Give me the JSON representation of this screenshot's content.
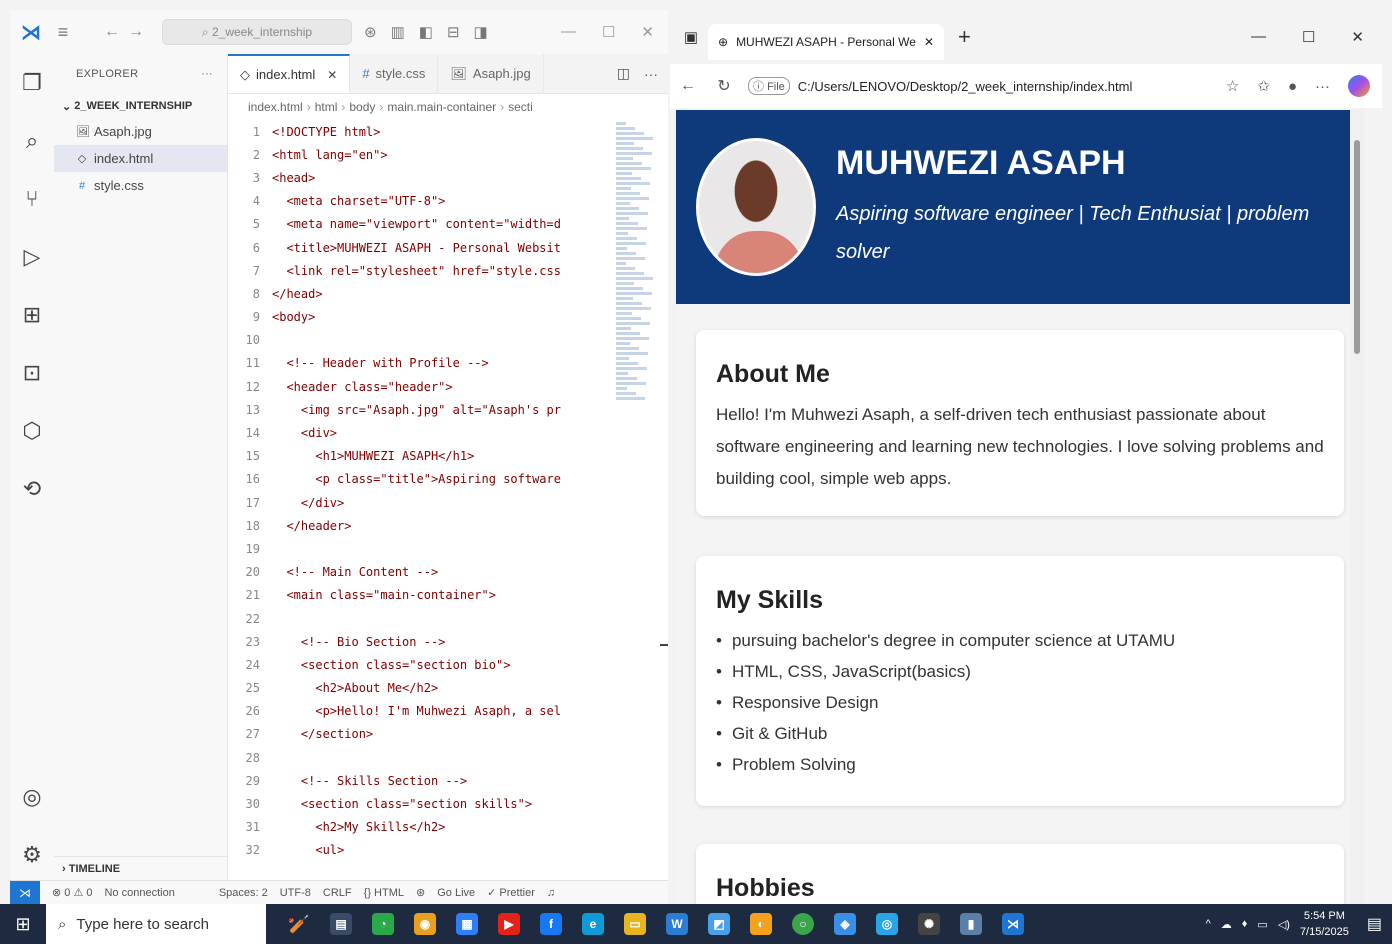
{
  "vscode": {
    "search_text": "2_week_internship",
    "explorer_label": "EXPLORER",
    "folder_name": "2_WEEK_INTERNSHIP",
    "files": [
      {
        "icon": "🖼",
        "name": "Asaph.jpg"
      },
      {
        "icon": "◇",
        "name": "index.html"
      },
      {
        "icon": "#",
        "name": "style.css"
      }
    ],
    "timeline_label": "TIMELINE",
    "tabs": [
      {
        "icon": "◇",
        "label": "index.html"
      },
      {
        "icon": "#",
        "label": "style.css"
      },
      {
        "icon": "🖼",
        "label": "Asaph.jpg"
      }
    ],
    "breadcrumb": [
      "index.html",
      "html",
      "body",
      "main.main-container",
      "secti"
    ],
    "code_lines": [
      {
        "n": "1",
        "text": "<!DOCTYPE html>"
      },
      {
        "n": "2",
        "text": "<html lang=\"en\">"
      },
      {
        "n": "3",
        "text": "<head>"
      },
      {
        "n": "4",
        "text": "  <meta charset=\"UTF-8\">"
      },
      {
        "n": "5",
        "text": "  <meta name=\"viewport\" content=\"width=d"
      },
      {
        "n": "6",
        "text": "  <title>MUHWEZI ASAPH - Personal Websit"
      },
      {
        "n": "7",
        "text": "  <link rel=\"stylesheet\" href=\"style.css"
      },
      {
        "n": "8",
        "text": "</head>"
      },
      {
        "n": "9",
        "text": "<body>"
      },
      {
        "n": "10",
        "text": ""
      },
      {
        "n": "11",
        "text": "  <!-- Header with Profile -->"
      },
      {
        "n": "12",
        "text": "  <header class=\"header\">"
      },
      {
        "n": "13",
        "text": "    <img src=\"Asaph.jpg\" alt=\"Asaph's pr"
      },
      {
        "n": "14",
        "text": "    <div>"
      },
      {
        "n": "15",
        "text": "      <h1>MUHWEZI ASAPH</h1>"
      },
      {
        "n": "16",
        "text": "      <p class=\"title\">Aspiring software"
      },
      {
        "n": "17",
        "text": "    </div>"
      },
      {
        "n": "18",
        "text": "  </header>"
      },
      {
        "n": "19",
        "text": ""
      },
      {
        "n": "20",
        "text": "  <!-- Main Content -->"
      },
      {
        "n": "21",
        "text": "  <main class=\"main-container\">"
      },
      {
        "n": "22",
        "text": ""
      },
      {
        "n": "23",
        "text": "    <!-- Bio Section -->"
      },
      {
        "n": "24",
        "text": "    <section class=\"section bio\">"
      },
      {
        "n": "25",
        "text": "      <h2>About Me</h2>"
      },
      {
        "n": "26",
        "text": "      <p>Hello! I'm Muhwezi Asaph, a sel"
      },
      {
        "n": "27",
        "text": "    </section>"
      },
      {
        "n": "28",
        "text": ""
      },
      {
        "n": "29",
        "text": "    <!-- Skills Section -->"
      },
      {
        "n": "30",
        "text": "    <section class=\"section skills\">"
      },
      {
        "n": "31",
        "text": "      <h2>My Skills</h2>"
      },
      {
        "n": "32",
        "text": "      <ul>"
      }
    ],
    "status": {
      "problems": "⊗ 0 ⚠ 0",
      "connection": "No connection",
      "spaces": "Spaces: 2",
      "encoding": "UTF-8",
      "eol": "CRLF",
      "language": "{} HTML",
      "golive": "Go Live",
      "prettier": "✓ Prettier"
    }
  },
  "edge": {
    "tab_title": "MUHWEZI ASAPH - Personal We",
    "file_chip": "File",
    "url": "C:/Users/LENOVO/Desktop/2_week_internship/index.html"
  },
  "site": {
    "name": "MUHWEZI ASAPH",
    "tagline": "Aspiring software engineer | Tech Enthusiat | problem solver",
    "about_title": "About Me",
    "about_text": "Hello! I'm Muhwezi Asaph, a self-driven tech enthusiast passionate about software engineering and learning new technologies. I love solving problems and building cool, simple web apps.",
    "skills_title": "My Skills",
    "skills": [
      "pursuing bachelor's degree in computer science at UTAMU",
      "HTML, CSS, JavaScript(basics)",
      "Responsive Design",
      "Git & GitHub",
      "Problem Solving"
    ],
    "hobbies_title": "Hobbies"
  },
  "taskbar": {
    "search_placeholder": "Type here to search",
    "time": "5:54 PM",
    "date": "7/15/2025"
  }
}
